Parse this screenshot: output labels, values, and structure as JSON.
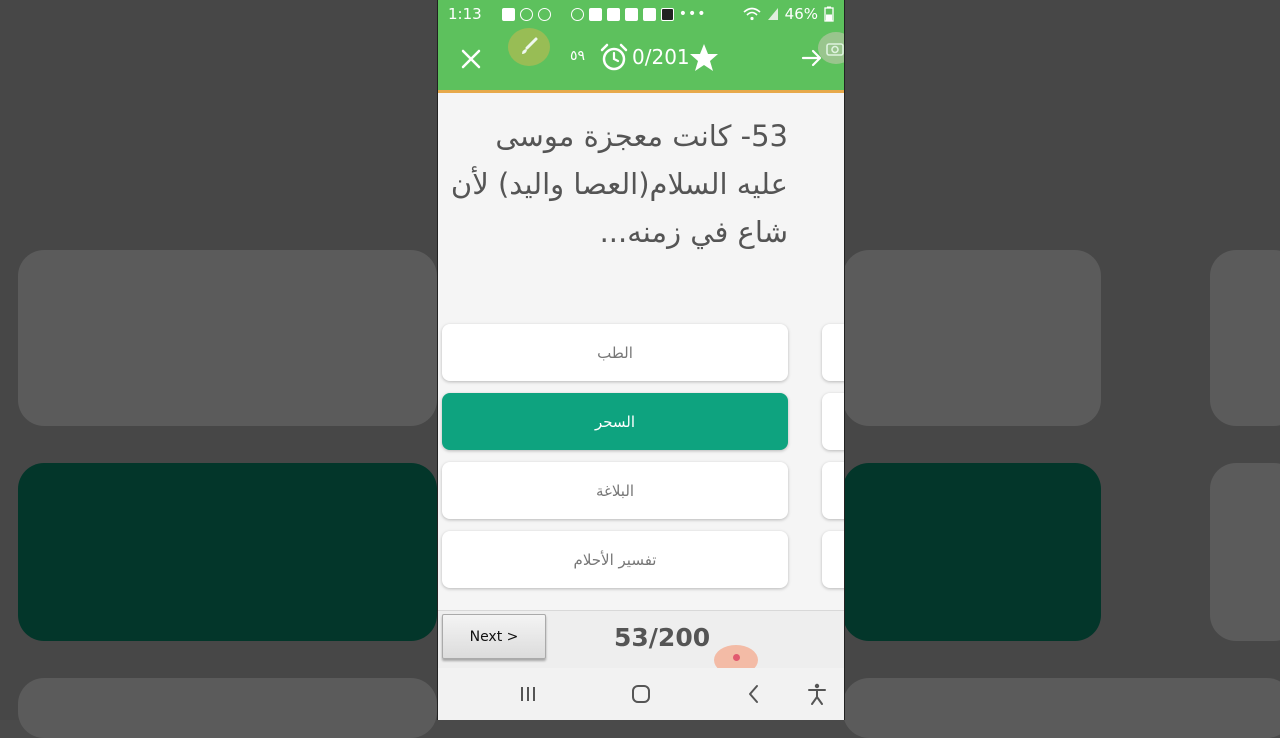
{
  "status_bar": {
    "time": "1:13",
    "battery": "46%"
  },
  "app_bar": {
    "question_number_arabic": "٥٩",
    "counter": "0/201"
  },
  "question": {
    "lines": [
      "53- كانت معجزة موسى",
      "عليه السلام(العصا واليد) لأن",
      "شاع في زمنه..."
    ]
  },
  "answers": [
    {
      "label": "الطب",
      "selected": false
    },
    {
      "label": "السحر",
      "selected": true
    },
    {
      "label": "البلاغة",
      "selected": false
    },
    {
      "label": "تفسير الأحلام",
      "selected": false
    }
  ],
  "footer": {
    "next_label": "Next >",
    "progress": "53/200"
  },
  "colors": {
    "app_bar": "#5dc15d",
    "selected_answer": "#0ea37f",
    "accent_line": "#e7a94b"
  }
}
